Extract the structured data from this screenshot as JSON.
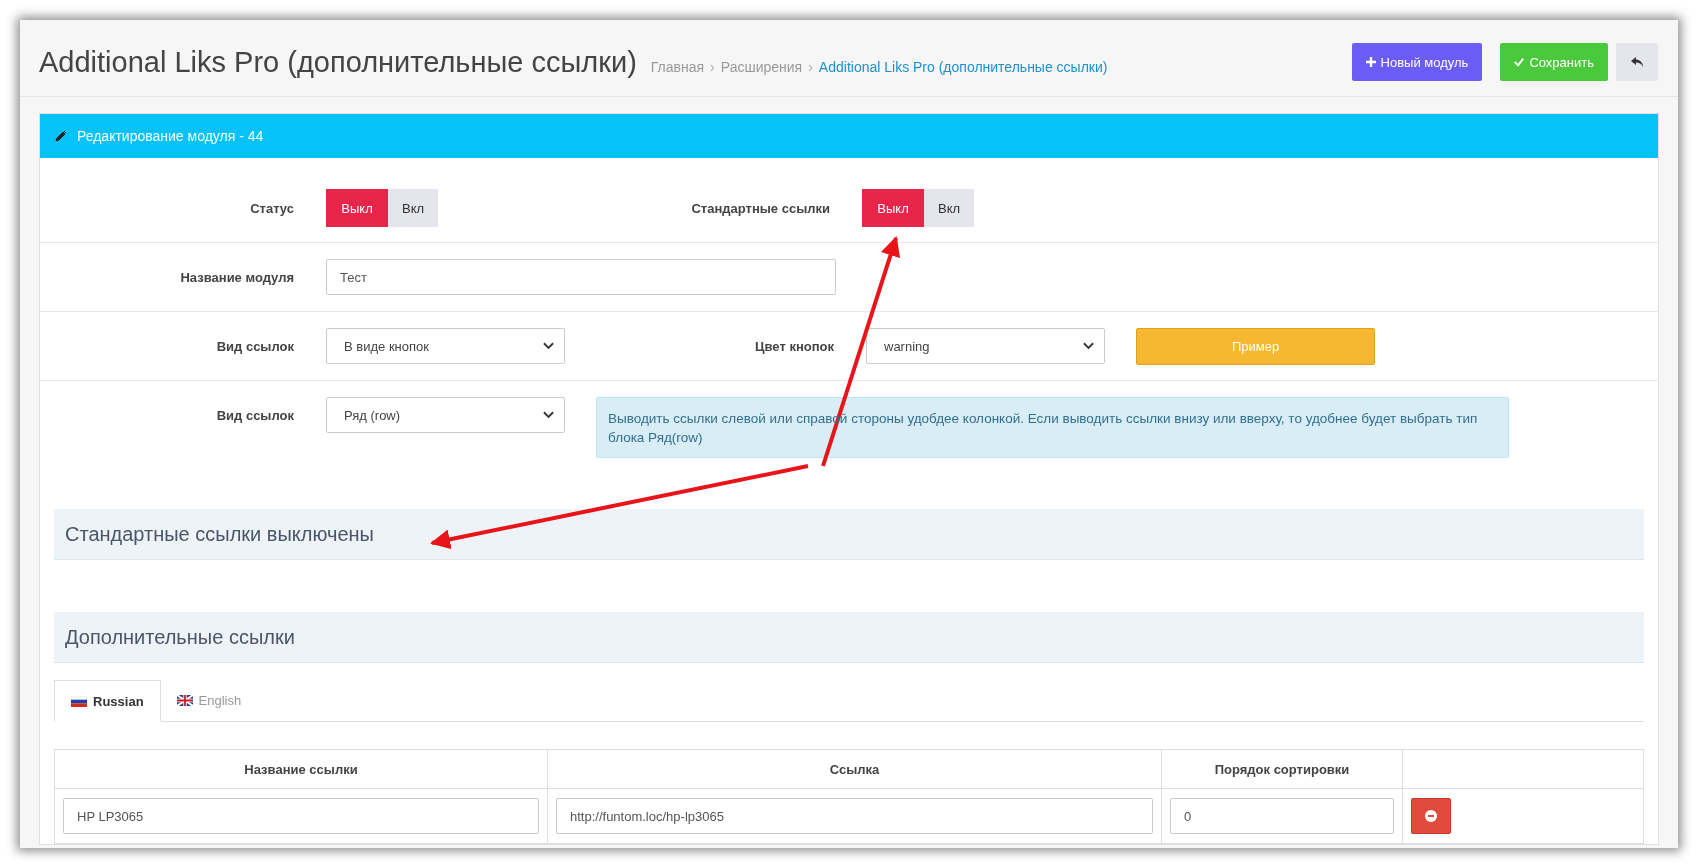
{
  "page": {
    "title": "Additional Liks Pro (дополнительные ссылки)",
    "breadcrumb_separator": "›",
    "breadcrumbs": [
      {
        "label": "Главная",
        "current": false
      },
      {
        "label": "Расширения",
        "current": false
      },
      {
        "label": "Additional Liks Pro (дополнительные ссылки)",
        "current": true
      }
    ],
    "buttons": [
      {
        "kind": "new",
        "label": "Новый модуль"
      },
      {
        "kind": "save",
        "label": "Сохранить"
      },
      {
        "kind": "back"
      }
    ]
  },
  "panel": {
    "title": "Редактирование модуля - 44",
    "rows": [
      {
        "fields": [
          {
            "kind": "toggle",
            "label": "Статус",
            "options": [
              {
                "label": "Выкл",
                "selected": true
              },
              {
                "label": "Вкл",
                "selected": false
              }
            ]
          },
          {
            "kind": "toggle",
            "label": "Стандартные ссылки",
            "options": [
              {
                "label": "Выкл",
                "selected": true
              },
              {
                "label": "Вкл",
                "selected": false
              }
            ]
          }
        ]
      },
      {
        "fields": [
          {
            "kind": "text",
            "label": "Название модуля",
            "value": "Тест"
          }
        ]
      },
      {
        "fields": [
          {
            "kind": "select",
            "label": "Вид ссылок",
            "value": "В виде кнопок"
          },
          {
            "kind": "select",
            "label": "Цвет кнопок",
            "value": "warning"
          },
          {
            "kind": "button",
            "label": "Пример"
          }
        ]
      },
      {
        "fields": [
          {
            "kind": "select",
            "label": "Вид ссылок",
            "value": "Ряд (row)"
          },
          {
            "kind": "info",
            "text": "Выводить ссылки слевой или справой стороны удобдее колонкой. Если выводить ссылки внизу или вверху, то удобнее будет выбрать тип блока Ряд(row)"
          }
        ]
      }
    ],
    "sections": [
      "Стандартные ссылки выключены",
      "Дополнительные ссылки"
    ],
    "tabs": [
      {
        "label": "Russian",
        "kind": "ru",
        "selected": true
      },
      {
        "label": "English",
        "kind": "en",
        "selected": false
      }
    ],
    "table": {
      "columns": [
        "Название ссылки",
        "Ссылка",
        "Порядок сортировки"
      ],
      "rows": [
        {
          "cells": [
            "HP LP3065",
            "http://funtom.loc/hp-lp3065",
            "0"
          ]
        }
      ]
    }
  }
}
